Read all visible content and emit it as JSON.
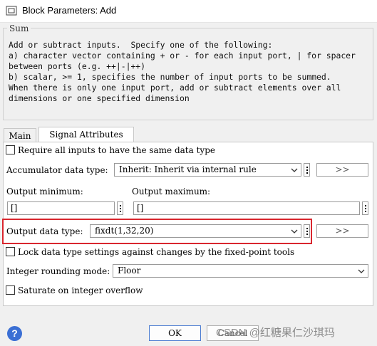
{
  "window": {
    "title": "Block Parameters: Add"
  },
  "description": {
    "group_label": "Sum",
    "text": "Add or subtract inputs.  Specify one of the following:\na) character vector containing + or - for each input port, | for spacer\nbetween ports (e.g. ++|-|++)\nb) scalar, >= 1, specifies the number of input ports to be summed.\nWhen there is only one input port, add or subtract elements over all\ndimensions or one specified dimension"
  },
  "tabs": [
    {
      "label": "Main",
      "active": false
    },
    {
      "label": "Signal Attributes",
      "active": true
    }
  ],
  "signal_attributes": {
    "require_same_type": {
      "label": "Require all inputs to have the same data type",
      "checked": false
    },
    "accumulator": {
      "label": "Accumulator data type:",
      "value": "Inherit: Inherit via internal rule",
      "assistant_label": ">>"
    },
    "output_minimum": {
      "label": "Output minimum:",
      "value": "[]"
    },
    "output_maximum": {
      "label": "Output maximum:",
      "value": "[]"
    },
    "output_data_type": {
      "label": "Output data type:",
      "value": "fixdt(1,32,20)",
      "assistant_label": ">>"
    },
    "lock_settings": {
      "label": "Lock data type settings against changes by the fixed-point tools",
      "checked": false
    },
    "rounding": {
      "label": "Integer rounding mode:",
      "value": "Floor"
    },
    "saturate": {
      "label": "Saturate on integer overflow",
      "checked": false
    }
  },
  "footer": {
    "help_glyph": "?",
    "ok_label": "OK",
    "cancel_label": "Cancel",
    "watermark": "CSDN @红糖果仁沙琪玛"
  },
  "colors": {
    "highlight": "#d9262e",
    "accent": "#3b6fd4"
  }
}
